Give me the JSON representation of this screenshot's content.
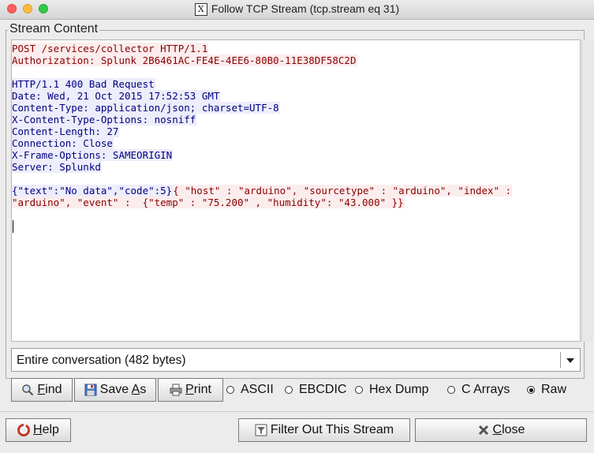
{
  "window": {
    "title": "Follow TCP Stream (tcp.stream eq 31)",
    "app_icon": "x11-icon"
  },
  "stream": {
    "group_label": "Stream Content",
    "client_color": "#8b0000",
    "server_color": "#000080",
    "lines": [
      {
        "dir": "client",
        "text": "POST /services/collector HTTP/1.1"
      },
      {
        "dir": "client",
        "text": "Authorization: Splunk 2B6461AC-FE4E-4EE6-80B0-11E38DF58C2D"
      },
      {
        "dir": "blank",
        "text": ""
      },
      {
        "dir": "server",
        "text": "HTTP/1.1 400 Bad Request"
      },
      {
        "dir": "server",
        "text": "Date: Wed, 21 Oct 2015 17:52:53 GMT"
      },
      {
        "dir": "server",
        "text": "Content-Type: application/json; charset=UTF-8"
      },
      {
        "dir": "server",
        "text": "X-Content-Type-Options: nosniff"
      },
      {
        "dir": "server",
        "text": "Content-Length: 27"
      },
      {
        "dir": "server",
        "text": "Connection: Close"
      },
      {
        "dir": "server",
        "text": "X-Frame-Options: SAMEORIGIN"
      },
      {
        "dir": "server",
        "text": "Server: Splunkd"
      },
      {
        "dir": "blank",
        "text": ""
      },
      {
        "dir": "mixed",
        "server_text": "{\"text\":\"No data\",\"code\":5}",
        "client_text": "{ \"host\" : \"arduino\", \"sourcetype\" : \"arduino\", \"index\" :"
      },
      {
        "dir": "client",
        "text": "\"arduino\", \"event\" :  {\"temp\" : \"75.200\" , \"humidity\": \"43.000\" }}"
      }
    ]
  },
  "conversation_select": {
    "selected": "Entire conversation (482 bytes)"
  },
  "toolbar": {
    "find_pre": "",
    "find_u": "F",
    "find_post": "ind",
    "saveas_pre": "Save ",
    "saveas_u": "A",
    "saveas_post": "s",
    "print_pre": "",
    "print_u": "P",
    "print_post": "rint"
  },
  "formats": {
    "selected": "Raw",
    "options": [
      "ASCII",
      "EBCDIC",
      "Hex Dump",
      "C Arrays",
      "Raw"
    ]
  },
  "footer": {
    "help_pre": "",
    "help_u": "H",
    "help_post": "elp",
    "filter_label": "Filter Out This Stream",
    "close_pre": "",
    "close_u": "C",
    "close_post": "lose"
  }
}
